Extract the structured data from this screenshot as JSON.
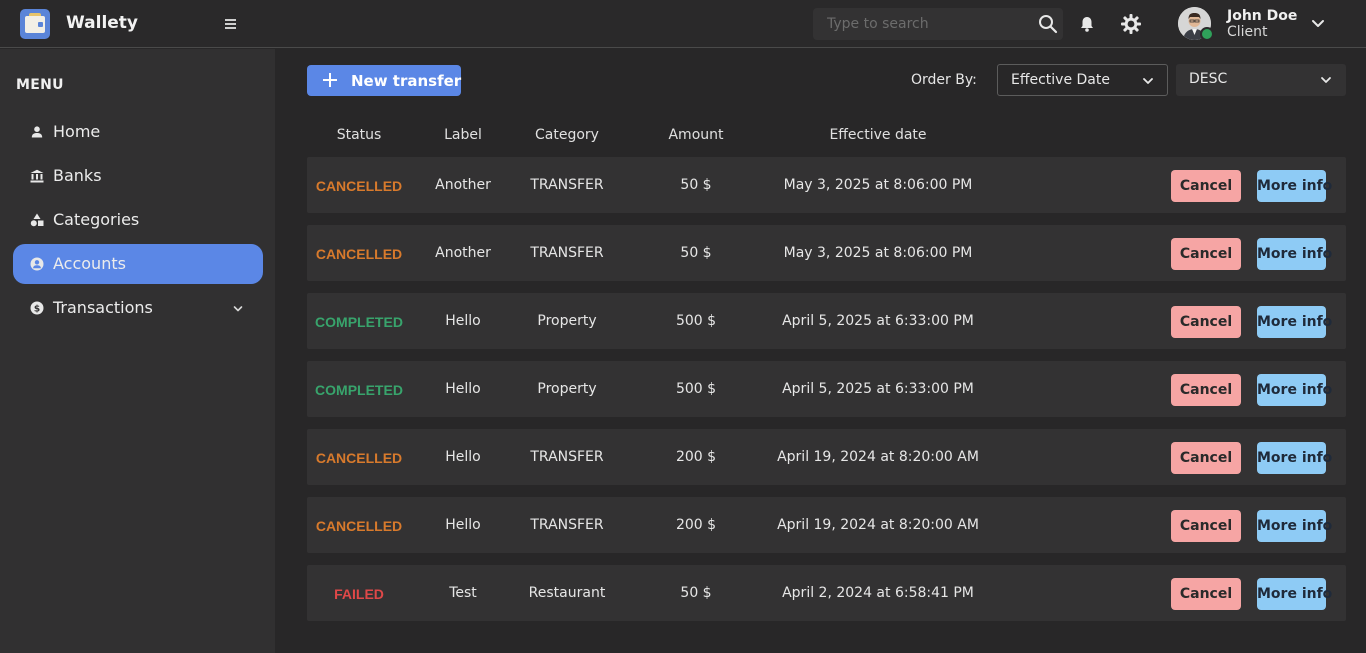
{
  "app": {
    "title": "Wallety"
  },
  "header": {
    "search_placeholder": "Type to search",
    "user": {
      "name": "John Doe",
      "role": "Client",
      "status_color": "#2fa15a"
    }
  },
  "sidebar": {
    "heading": "MENU",
    "items": [
      {
        "label": "Home",
        "icon": "person-icon",
        "active": false
      },
      {
        "label": "Banks",
        "icon": "bank-icon",
        "active": false
      },
      {
        "label": "Categories",
        "icon": "shapes-icon",
        "active": false
      },
      {
        "label": "Accounts",
        "icon": "user-circle-icon",
        "active": true
      },
      {
        "label": "Transactions",
        "icon": "dollar-circle-icon",
        "active": false,
        "expandable": true
      }
    ]
  },
  "toolbar": {
    "new_transfer_label": "New transfer",
    "order_by_label": "Order By:",
    "order_by_value": "Effective Date",
    "order_dir_value": "DESC"
  },
  "table": {
    "columns": [
      "Status",
      "Label",
      "Category",
      "Amount",
      "Effective date"
    ],
    "cancel_label": "Cancel",
    "more_info_label": "More info",
    "rows": [
      {
        "status": "CANCELLED",
        "label": "Another",
        "category": "TRANSFER",
        "amount": "50 $",
        "date": "May 3, 2025 at 8:06:00 PM"
      },
      {
        "status": "CANCELLED",
        "label": "Another",
        "category": "TRANSFER",
        "amount": "50 $",
        "date": "May 3, 2025 at 8:06:00 PM"
      },
      {
        "status": "COMPLETED",
        "label": "Hello",
        "category": "Property",
        "amount": "500 $",
        "date": "April 5, 2025 at 6:33:00 PM"
      },
      {
        "status": "COMPLETED",
        "label": "Hello",
        "category": "Property",
        "amount": "500 $",
        "date": "April 5, 2025 at 6:33:00 PM"
      },
      {
        "status": "CANCELLED",
        "label": "Hello",
        "category": "TRANSFER",
        "amount": "200 $",
        "date": "April 19, 2024 at 8:20:00 AM"
      },
      {
        "status": "CANCELLED",
        "label": "Hello",
        "category": "TRANSFER",
        "amount": "200 $",
        "date": "April 19, 2024 at 8:20:00 AM"
      },
      {
        "status": "FAILED",
        "label": "Test",
        "category": "Restaurant",
        "amount": "50 $",
        "date": "April 2, 2024 at 6:58:41 PM"
      }
    ]
  },
  "colors": {
    "accent": "#5b87e6",
    "cancelled": "#d87a2c",
    "completed": "#38a46c",
    "failed": "#e04848",
    "cancel_button": "#f6a5a4",
    "more_info_button": "#8ecbf5"
  }
}
